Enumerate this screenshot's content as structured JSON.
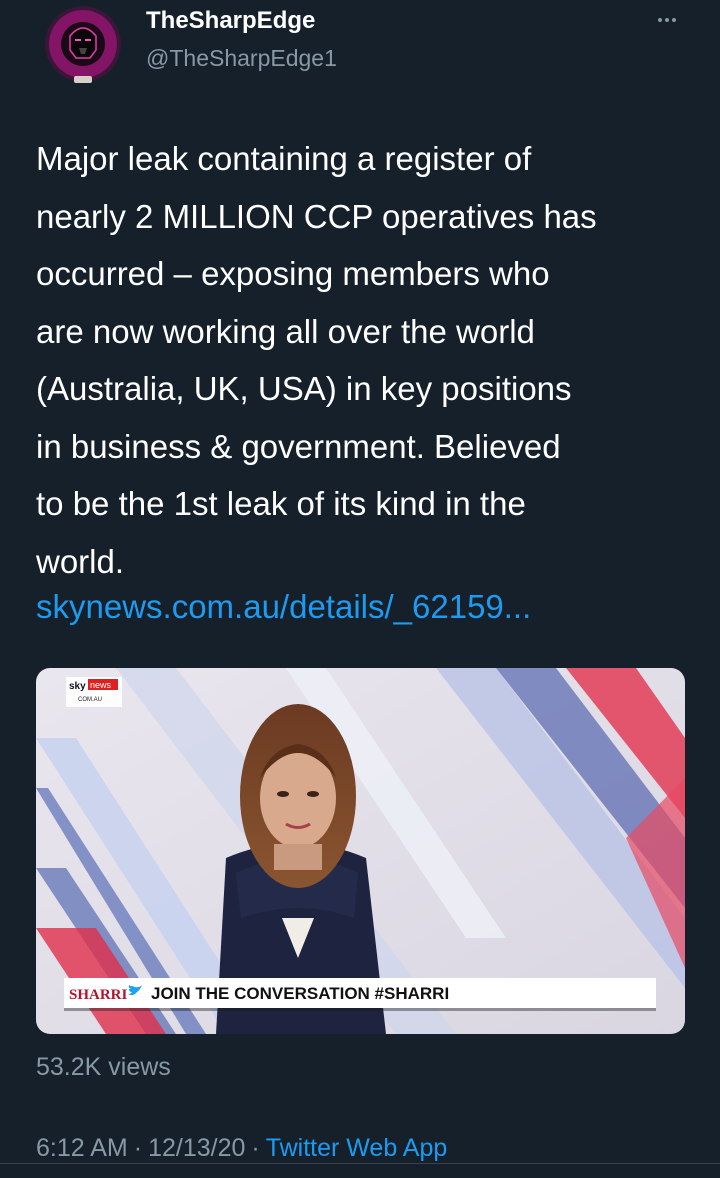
{
  "author": {
    "name": "TheSharpEdge",
    "handle": "@TheSharpEdge1",
    "avatar_icon": "darth-vader-avatar-icon"
  },
  "more_icon": "more-horizontal-icon",
  "tweet": {
    "text_lines": [
      "Major leak containing a register of",
      "nearly 2 MILLION CCP operatives has",
      "occurred – exposing members who",
      "are now working all over the world",
      "(Australia, UK, USA) in key positions",
      "in business & government. Believed",
      "to be the 1st leak of its kind in the",
      "world."
    ],
    "link": "skynews.com.au/details/_62159..."
  },
  "media": {
    "channel_logo_sky": "sky",
    "channel_logo_news": "news",
    "channel_logo_sub": "COM.AU",
    "ticker_show": "SHARRI",
    "ticker_icon": "twitter-bird-icon",
    "ticker_text": "JOIN THE CONVERSATION #SHARRI",
    "views": "53.2K views"
  },
  "meta": {
    "time": "6:12 AM",
    "date": "12/13/20",
    "separator": "·",
    "source": "Twitter Web App"
  },
  "colors": {
    "background": "#15202b",
    "link": "#1d9bf0",
    "secondary_text": "#8899a6"
  }
}
